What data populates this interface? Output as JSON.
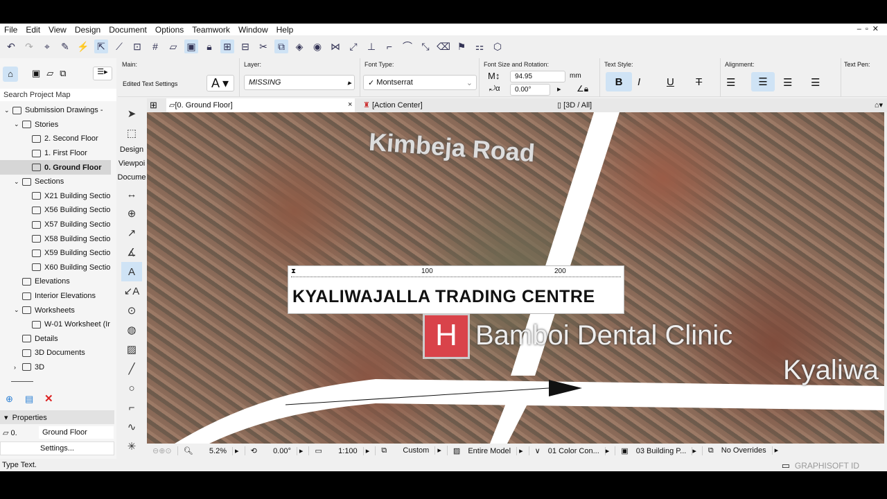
{
  "menu": [
    "File",
    "Edit",
    "View",
    "Design",
    "Document",
    "Options",
    "Teamwork",
    "Window",
    "Help"
  ],
  "infobox": {
    "main_label": "Main:",
    "main_value": "Edited Text Settings",
    "layer_label": "Layer:",
    "layer_value": "MISSING",
    "font_label": "Font Type:",
    "font_value": "Montserrat",
    "size_label": "Font Size and Rotation:",
    "size_value": "94.95",
    "size_unit": "mm",
    "rotation_value": "0.00°",
    "style_label": "Text Style:",
    "bold": "B",
    "italic": "I",
    "underline": "U",
    "strike": "T",
    "align_label": "Alignment:",
    "pen_label": "Text Pen:"
  },
  "navigator": {
    "search_placeholder": "Search Project Map",
    "items": [
      {
        "label": "Submission Drawings -",
        "level": 0,
        "arrow": "v"
      },
      {
        "label": "Stories",
        "level": 1,
        "arrow": "v"
      },
      {
        "label": "2. Second Floor",
        "level": 2
      },
      {
        "label": "1. First Floor",
        "level": 2
      },
      {
        "label": "0. Ground Floor",
        "level": 2,
        "selected": true
      },
      {
        "label": "Sections",
        "level": 1,
        "arrow": "v"
      },
      {
        "label": "X21 Building Sectio",
        "level": 2
      },
      {
        "label": "X56 Building Sectio",
        "level": 2
      },
      {
        "label": "X57 Building Sectio",
        "level": 2
      },
      {
        "label": "X58 Building Sectio",
        "level": 2
      },
      {
        "label": "X59 Building Sectio",
        "level": 2
      },
      {
        "label": "X60 Building Sectio",
        "level": 2
      },
      {
        "label": "Elevations",
        "level": 1
      },
      {
        "label": "Interior Elevations",
        "level": 1
      },
      {
        "label": "Worksheets",
        "level": 1,
        "arrow": "v"
      },
      {
        "label": "W-01 Worksheet (Ir",
        "level": 2
      },
      {
        "label": "Details",
        "level": 1
      },
      {
        "label": "3D Documents",
        "level": 1
      },
      {
        "label": "3D",
        "level": 1,
        "arrow": ">"
      }
    ],
    "properties_label": "Properties",
    "prop_id": "0.",
    "prop_value": "Ground Floor",
    "settings": "Settings..."
  },
  "toolbox": {
    "design": "Design",
    "viewpoint": "Viewpoi",
    "document": "Docume"
  },
  "tabs": {
    "floor": "[0. Ground Floor]",
    "close": "×",
    "action": "[Action Center]",
    "three_d": "[3D / All]"
  },
  "canvas": {
    "road_label": "Kimbeja Road",
    "title_text": "KYALIWAJALLA TRADING CENTRE",
    "ruler_100": "100",
    "ruler_200": "200",
    "clinic_icon": "H",
    "clinic_label": "Bamboi Dental Clinic",
    "edge_label": "Kyaliwa"
  },
  "bottombar": {
    "zoom": "5.2%",
    "angle": "0.00°",
    "scale": "1:100",
    "layers": "Custom",
    "model": "Entire Model",
    "pen": "01 Color Con...",
    "view": "03 Building P...",
    "overrides": "No Overrides"
  },
  "status": {
    "text": "Type Text.",
    "brand": "GRAPHISOFT ID"
  }
}
